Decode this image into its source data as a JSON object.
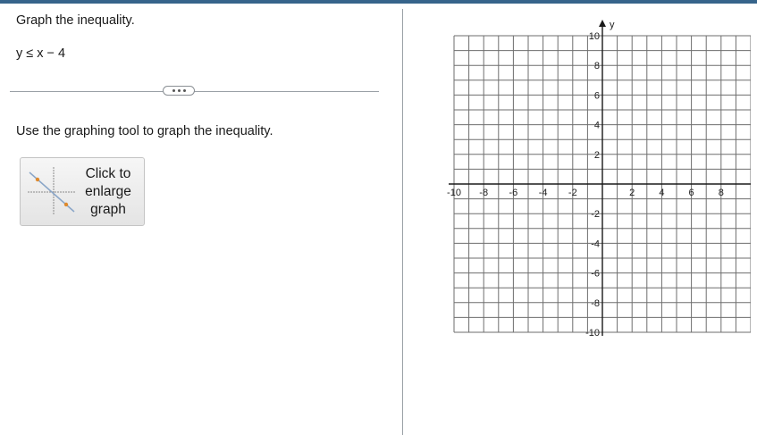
{
  "question": {
    "prompt": "Graph the inequality.",
    "expression": "y ≤ x − 4",
    "instruction": "Use the graphing tool to graph the inequality."
  },
  "more_button": {
    "icon": "ellipsis-icon"
  },
  "enlarge_button": {
    "label": "Click to\nenlarge\ngraph",
    "icon": "graph-thumbnail-icon"
  },
  "graph": {
    "x_range": [
      -10,
      10
    ],
    "y_range": [
      -10,
      10
    ],
    "grid_step": 1,
    "x_tick_labels": [
      "-10",
      "-8",
      "-6",
      "-4",
      "-2",
      "2",
      "4",
      "6",
      "8"
    ],
    "y_tick_labels": [
      "10",
      "8",
      "6",
      "4",
      "2",
      "-2",
      "-4",
      "-6",
      "-8",
      "-10"
    ],
    "y_axis_label": "y",
    "grid_color": "#6e6e6e",
    "axis_color": "#1a1a1a"
  },
  "colors": {
    "top_bar": "#36648b"
  }
}
